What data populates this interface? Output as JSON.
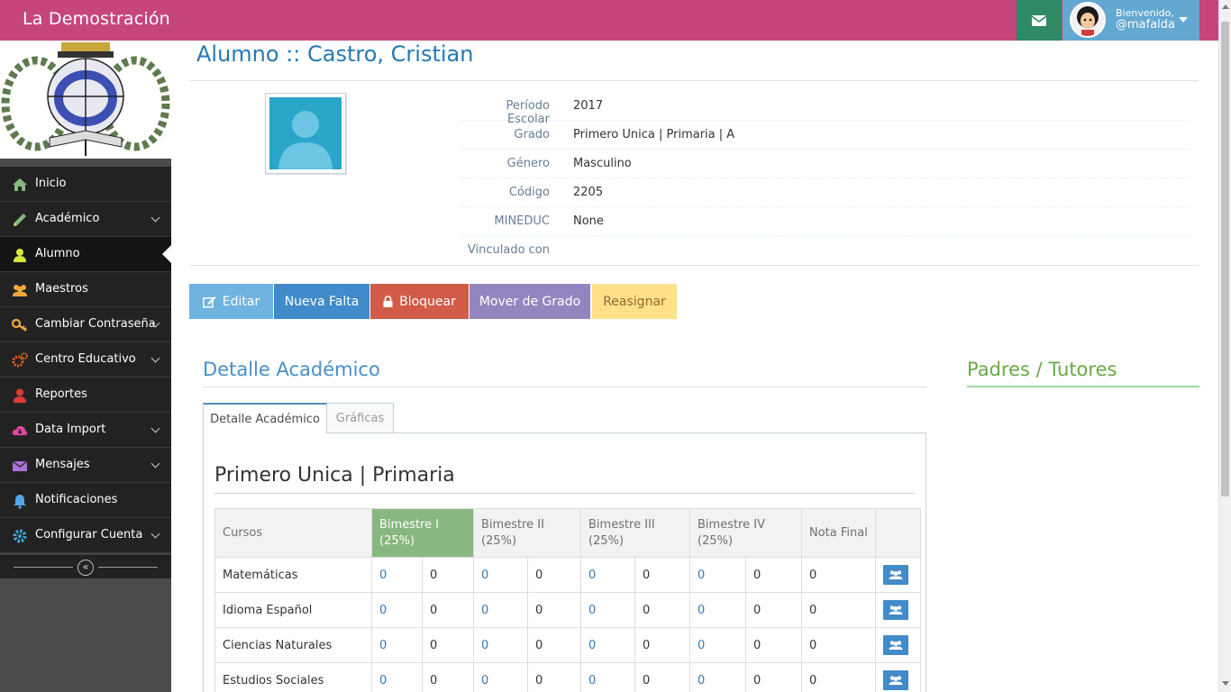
{
  "navbar": {
    "brand": "La Demostración",
    "user_greeting": "Bienvenido,",
    "user_name": "@mafalda"
  },
  "sidebar": {
    "items": [
      {
        "label": "Inicio",
        "icon": "home-icon",
        "has_submenu": false,
        "active": false,
        "icon_color": "#87b87f"
      },
      {
        "label": "Académico",
        "icon": "pencil-icon",
        "has_submenu": true,
        "active": false,
        "icon_color": "#87b87f"
      },
      {
        "label": "Alumno",
        "icon": "user-icon",
        "has_submenu": false,
        "active": true,
        "icon_color": "#d6e73b"
      },
      {
        "label": "Maestros",
        "icon": "group-icon",
        "has_submenu": false,
        "active": false,
        "icon_color": "#f0a73a"
      },
      {
        "label": "Cambiar Contraseña",
        "icon": "key-icon",
        "has_submenu": true,
        "active": false,
        "icon_color": "#f0a73a"
      },
      {
        "label": "Centro Educativo",
        "icon": "cogs-icon",
        "has_submenu": true,
        "active": false,
        "icon_color": "#e8641b"
      },
      {
        "label": "Reportes",
        "icon": "user-red-icon",
        "has_submenu": false,
        "active": false,
        "icon_color": "#dd3b3b"
      },
      {
        "label": "Data Import",
        "icon": "cloud-download-icon",
        "has_submenu": true,
        "active": false,
        "icon_color": "#e0479c"
      },
      {
        "label": "Mensajes",
        "icon": "envelope-icon",
        "has_submenu": true,
        "active": false,
        "icon_color": "#a972d8"
      },
      {
        "label": "Notificaciones",
        "icon": "bell-icon",
        "has_submenu": false,
        "active": false,
        "icon_color": "#4fa6e8"
      },
      {
        "label": "Configurar Cuenta",
        "icon": "cog-icon",
        "has_submenu": true,
        "active": false,
        "icon_color": "#3ea6d8"
      }
    ]
  },
  "page": {
    "title": "Alumno :: Castro, Cristian"
  },
  "profile": {
    "fields": [
      {
        "label": "Período Escolar",
        "value": "2017"
      },
      {
        "label": "Grado",
        "value": "Primero Unica | Primaria | A"
      },
      {
        "label": "Género",
        "value": "Masculino"
      },
      {
        "label": "Código",
        "value": "2205"
      },
      {
        "label": "MINEDUC",
        "value": "None"
      },
      {
        "label": "Vinculado con",
        "value": ""
      }
    ]
  },
  "actions": {
    "edit": "Editar",
    "new_absence": "Nueva Falta",
    "block": "Bloquear",
    "move_grade": "Mover de Grado",
    "reassign": "Reasignar"
  },
  "sections": {
    "academic_detail": "Detalle Académico",
    "parents": "Padres / Tutores"
  },
  "tabs": {
    "detail": "Detalle Académico",
    "charts": "Gráficas"
  },
  "grades": {
    "title": "Primero Unica | Primaria",
    "headers": {
      "courses": "Cursos",
      "b1": [
        "Bimestre I",
        "(25%)"
      ],
      "b2": [
        "Bimestre II",
        "(25%)"
      ],
      "b3": [
        "Bimestre III",
        "(25%)"
      ],
      "b4": [
        "Bimestre IV",
        "(25%)"
      ],
      "final": "Nota Final"
    },
    "rows": [
      {
        "course": "Matemáticas",
        "values": [
          "0",
          "0",
          "0",
          "0",
          "0",
          "0",
          "0",
          "0"
        ],
        "final": "0"
      },
      {
        "course": "Idioma Español",
        "values": [
          "0",
          "0",
          "0",
          "0",
          "0",
          "0",
          "0",
          "0"
        ],
        "final": "0"
      },
      {
        "course": "Ciencias Naturales",
        "values": [
          "0",
          "0",
          "0",
          "0",
          "0",
          "0",
          "0",
          "0"
        ],
        "final": "0"
      },
      {
        "course": "Estudios Sociales",
        "values": [
          "0",
          "0",
          "0",
          "0",
          "0",
          "0",
          "0",
          "0"
        ],
        "final": "0"
      }
    ]
  }
}
